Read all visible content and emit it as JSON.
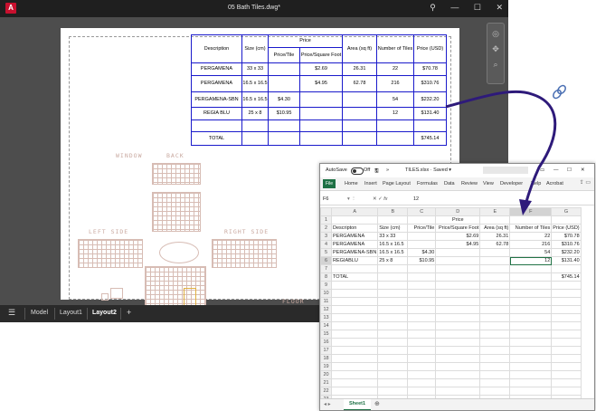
{
  "cad": {
    "app_icon": "A",
    "title": "05 Bath Tiles.dwg*",
    "title_bar_icons": [
      "pin-icon",
      "minimize-icon",
      "maximize-icon",
      "close-icon"
    ],
    "tabs": [
      {
        "label": "Model"
      },
      {
        "label": "Layout1"
      },
      {
        "label": "Layout2"
      }
    ],
    "add_tab": "+",
    "table": {
      "header": [
        "Description",
        "Size (cm)",
        "Price",
        "Area (sq ft)",
        "Number of Tiles",
        "Price (USD)"
      ],
      "subheader": [
        "Price/Tile",
        "Price/Square Foot"
      ],
      "rows": [
        [
          "PERGAMENA",
          "33 x 33",
          "",
          "$2.69",
          "26.31",
          "22",
          "$70.78"
        ],
        [
          "PERGAMENA",
          "16.5 x 16.5",
          "",
          "$4.95",
          "62.78",
          "216",
          "$310.76"
        ],
        [
          "PERGAMENA-SBN",
          "16.5 x 16.5",
          "$4.30",
          "",
          "",
          "54",
          "$232.20"
        ],
        [
          "REGIA BLU",
          "25 x 8",
          "$10.95",
          "",
          "",
          "12",
          "$131.40"
        ],
        [
          "",
          "",
          "",
          "",
          "",
          "",
          ""
        ],
        [
          "TOTAL",
          "",
          "",
          "",
          "",
          "",
          "$745.14"
        ]
      ]
    },
    "plan_labels": {
      "window": "WINDOW",
      "back": "BACK",
      "left": "LEFT SIDE",
      "right": "RIGHT SIDE",
      "floor": "FLOOR"
    }
  },
  "excel": {
    "autosave_label": "AutoSave",
    "autosave_state": "Off",
    "file_title": "TILES.xlsx · Saved ▾",
    "ribbon_tabs": [
      "File",
      "Home",
      "Insert",
      "Page Layout",
      "Formulas",
      "Data",
      "Review",
      "View",
      "Developer",
      "Help",
      "Acrobat"
    ],
    "name_box": "F6",
    "formula_value": "12",
    "columns": [
      "A",
      "B",
      "C",
      "D",
      "E",
      "F",
      "G"
    ],
    "rows": [
      {
        "n": "1",
        "cells": [
          "",
          "",
          "",
          "Price",
          "",
          "",
          ""
        ]
      },
      {
        "n": "2",
        "cells": [
          "Descripton",
          "Size (cm)",
          "Price/Tile",
          "Price/Square Foot",
          "Area (sq ft)",
          "Number of Tiles",
          "Price (USD)"
        ]
      },
      {
        "n": "3",
        "cells": [
          "PERGAMENA",
          "33 x 33",
          "",
          "$2.69",
          "26.31",
          "22",
          "$70.78"
        ]
      },
      {
        "n": "4",
        "cells": [
          "PERGAMENA",
          "16.5 x 16.5",
          "",
          "$4.95",
          "62.78",
          "216",
          "$310.76"
        ]
      },
      {
        "n": "5",
        "cells": [
          "PERGAMENA-SBN",
          "16.5 x 16.5",
          "$4.30",
          "",
          "",
          "54",
          "$232.20"
        ]
      },
      {
        "n": "6",
        "cells": [
          "REGIABLU",
          "25 x 8",
          "$10.95",
          "",
          "",
          "12",
          "$131.40"
        ]
      },
      {
        "n": "7",
        "cells": [
          "",
          "",
          "",
          "",
          "",
          "",
          ""
        ]
      },
      {
        "n": "8",
        "cells": [
          "TOTAL",
          "",
          "",
          "",
          "",
          "",
          "$745.14"
        ]
      },
      {
        "n": "9",
        "cells": [
          "",
          "",
          "",
          "",
          "",
          "",
          ""
        ]
      },
      {
        "n": "10",
        "cells": [
          "",
          "",
          "",
          "",
          "",
          "",
          ""
        ]
      },
      {
        "n": "11",
        "cells": [
          "",
          "",
          "",
          "",
          "",
          "",
          ""
        ]
      },
      {
        "n": "12",
        "cells": [
          "",
          "",
          "",
          "",
          "",
          "",
          ""
        ]
      },
      {
        "n": "13",
        "cells": [
          "",
          "",
          "",
          "",
          "",
          "",
          ""
        ]
      },
      {
        "n": "14",
        "cells": [
          "",
          "",
          "",
          "",
          "",
          "",
          ""
        ]
      },
      {
        "n": "15",
        "cells": [
          "",
          "",
          "",
          "",
          "",
          "",
          ""
        ]
      },
      {
        "n": "16",
        "cells": [
          "",
          "",
          "",
          "",
          "",
          "",
          ""
        ]
      },
      {
        "n": "17",
        "cells": [
          "",
          "",
          "",
          "",
          "",
          "",
          ""
        ]
      },
      {
        "n": "18",
        "cells": [
          "",
          "",
          "",
          "",
          "",
          "",
          ""
        ]
      },
      {
        "n": "19",
        "cells": [
          "",
          "",
          "",
          "",
          "",
          "",
          ""
        ]
      },
      {
        "n": "20",
        "cells": [
          "",
          "",
          "",
          "",
          "",
          "",
          ""
        ]
      },
      {
        "n": "21",
        "cells": [
          "",
          "",
          "",
          "",
          "",
          "",
          ""
        ]
      },
      {
        "n": "22",
        "cells": [
          "",
          "",
          "",
          "",
          "",
          "",
          ""
        ]
      },
      {
        "n": "23",
        "cells": [
          "",
          "",
          "",
          "",
          "",
          "",
          ""
        ]
      }
    ],
    "sheet_tab": "Sheet1"
  },
  "colors": {
    "cad_table_border": "#1a1acb",
    "arrow": "#2e1a7a",
    "excel_green": "#1e7145"
  }
}
